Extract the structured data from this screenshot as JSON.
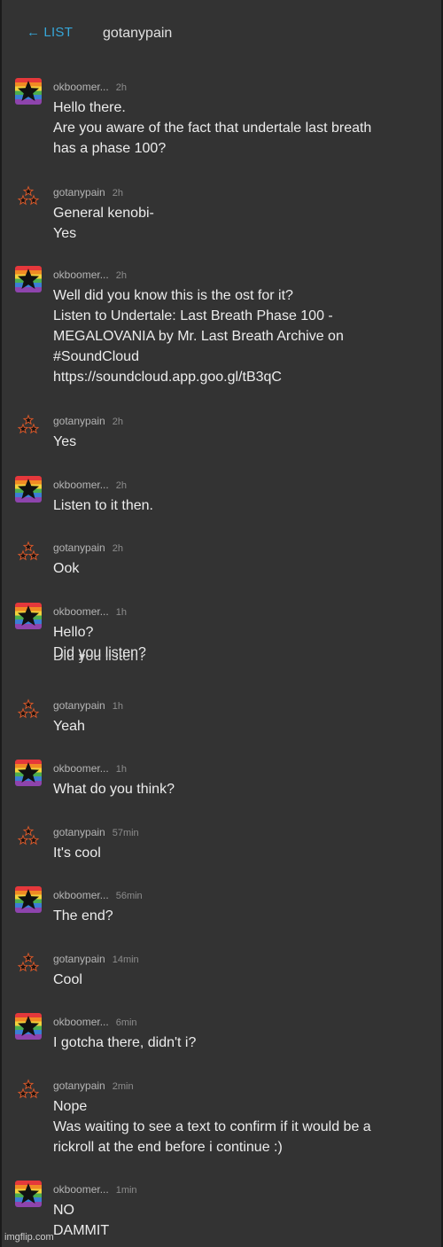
{
  "header": {
    "back_label": "LIST",
    "back_arrow": "←",
    "title": "gotanypain"
  },
  "users": {
    "a": "okboomer...",
    "b": "gotanypain"
  },
  "messages": [
    {
      "user": "okboomer...",
      "time": "2h",
      "lines": [
        "Hello there.",
        "Are you aware of the fact that undertale last breath",
        "has a phase 100?"
      ]
    },
    {
      "user": "gotanypain",
      "time": "2h",
      "lines": [
        "General kenobi-",
        "Yes"
      ]
    },
    {
      "user": "okboomer...",
      "time": "2h",
      "lines": [
        "Well did you know this is the ost for it?",
        "Listen to Undertale: Last Breath Phase 100 -",
        "MEGALOVANIA by Mr. Last Breath Archive on",
        "#SoundCloud",
        "https://soundcloud.app.goo.gl/tB3qC"
      ]
    },
    {
      "user": "gotanypain",
      "time": "2h",
      "lines": [
        "Yes"
      ]
    },
    {
      "user": "okboomer...",
      "time": "2h",
      "lines": [
        "Listen to it then."
      ]
    },
    {
      "user": "gotanypain",
      "time": "2h",
      "lines": [
        "Ook"
      ]
    },
    {
      "user": "okboomer...",
      "time": "1h",
      "lines": [
        "Hello?",
        "Did you listen?"
      ],
      "glitch": "Did you listen?"
    },
    {
      "user": "gotanypain",
      "time": "1h",
      "lines": [
        "Yeah"
      ]
    },
    {
      "user": "okboomer...",
      "time": "1h",
      "lines": [
        "What do you think?"
      ]
    },
    {
      "user": "gotanypain",
      "time": "57min",
      "lines": [
        "It's cool"
      ]
    },
    {
      "user": "okboomer...",
      "time": "56min",
      "lines": [
        "The end?"
      ]
    },
    {
      "user": "gotanypain",
      "time": "14min",
      "lines": [
        "Cool"
      ]
    },
    {
      "user": "okboomer...",
      "time": "6min",
      "lines": [
        "I gotcha there, didn't i?"
      ]
    },
    {
      "user": "gotanypain",
      "time": "2min",
      "lines": [
        "Nope",
        "Was waiting to see a text to confirm if it would be a",
        "rickroll at the end before i continue :)"
      ]
    },
    {
      "user": "okboomer...",
      "time": "1min",
      "lines": [
        "NO",
        "DAMMIT"
      ]
    }
  ],
  "avatar_icons": {
    "okboomer...": "rainbow-star-icon",
    "gotanypain": "three-stars-icon"
  },
  "colors": {
    "background": "#333333",
    "link": "#36a6d8",
    "text": "#ececec",
    "meta": "#b5b5b5"
  },
  "footer": {
    "watermark": "imgflip.com"
  }
}
